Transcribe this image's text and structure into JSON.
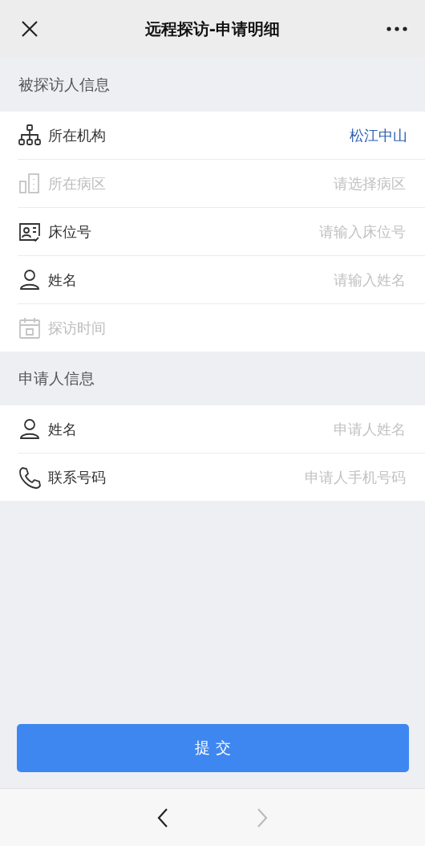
{
  "nav_bar": {
    "title": "远程探访-申请明细"
  },
  "sections": [
    {
      "title": "被探访人信息",
      "rows": [
        {
          "kind": "organization",
          "label": "所在机构",
          "value": "松江中山",
          "disabled": false
        },
        {
          "kind": "ward",
          "label": "所在病区",
          "placeholder": "请选择病区",
          "disabled": true
        },
        {
          "kind": "bed",
          "label": "床位号",
          "placeholder": "请输入床位号",
          "disabled": false
        },
        {
          "kind": "name",
          "label": "姓名",
          "placeholder": "请输入姓名",
          "disabled": false
        },
        {
          "kind": "time",
          "label": "探访时间",
          "disabled": true
        }
      ]
    },
    {
      "title": "申请人信息",
      "rows": [
        {
          "kind": "name",
          "label": "姓名",
          "placeholder": "申请人姓名",
          "disabled": false
        },
        {
          "kind": "phone",
          "label": "联系号码",
          "placeholder": "申请人手机号码",
          "disabled": false
        }
      ]
    }
  ],
  "submit_button": "提 交",
  "browser_bar": {
    "back_disabled": false,
    "forward_disabled": true
  }
}
